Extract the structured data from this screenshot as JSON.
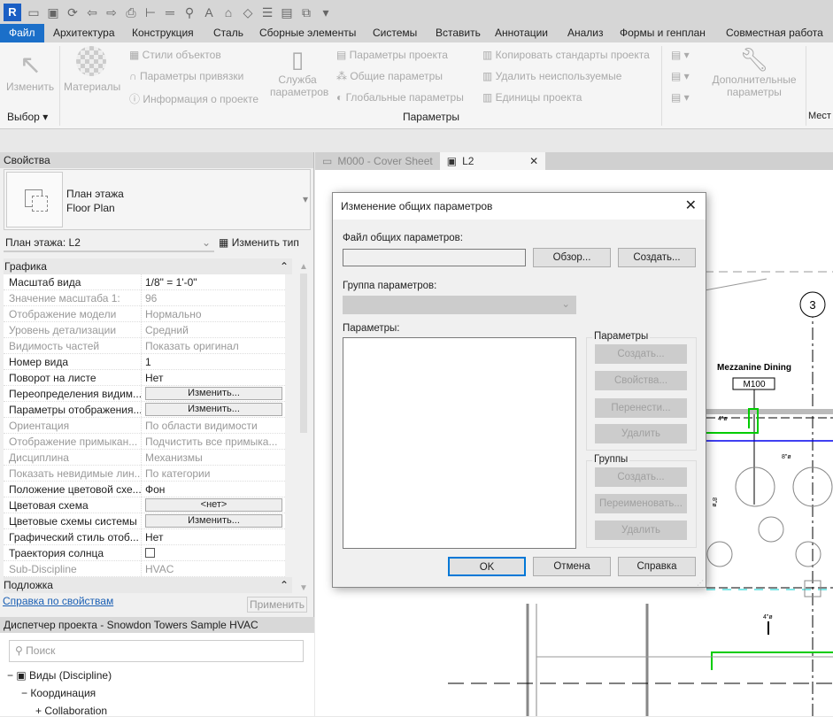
{
  "app": {
    "logo": "R",
    "qat_icons": [
      "open-icon",
      "save-icon",
      "sync-icon",
      "undo-icon",
      "redo-icon",
      "print-icon",
      "measure-icon",
      "dimension-icon",
      "tag-icon",
      "text-icon",
      "home-icon",
      "section-icon",
      "thin-lines-icon",
      "close-windows-icon",
      "switch-windows-icon",
      "customize-icon"
    ]
  },
  "ribbon_tabs": [
    "Файл",
    "Архитектура",
    "Конструкция",
    "Сталь",
    "Сборные элементы",
    "Системы",
    "Вставить",
    "Аннотации",
    "Анализ",
    "Формы и генплан",
    "Совместная работа"
  ],
  "ribbon": {
    "modify": "Изменить",
    "materials": "Материалы",
    "col1": [
      "Стили объектов",
      "Параметры привязки",
      "Информация о проекте"
    ],
    "service": [
      "Служба",
      "параметров"
    ],
    "col2": [
      "Параметры проекта",
      "Общие параметры",
      "Глобальные  параметры"
    ],
    "col3": [
      "Копировать стандарты проекта",
      "Удалить неиспользуемые",
      "Единицы проекта"
    ],
    "additional": [
      "Дополнительные",
      "параметры"
    ],
    "panel_select": "Выбор",
    "panel_params": "Параметры",
    "panel_next": "Мест"
  },
  "properties": {
    "header": "Свойства",
    "type_line1": "План этажа",
    "type_line2": "Floor Plan",
    "instance": "План этажа: L2",
    "edit_type": "Изменить тип",
    "group_graphics": "Графика",
    "rows": [
      {
        "k": "Масштаб вида",
        "v": "1/8\" = 1'-0\"",
        "dis": false
      },
      {
        "k": "Значение масштаба    1:",
        "v": "96",
        "dis": true
      },
      {
        "k": "Отображение модели",
        "v": "Нормально",
        "dis": true
      },
      {
        "k": "Уровень детализации",
        "v": "Средний",
        "dis": true
      },
      {
        "k": "Видимость частей",
        "v": "Показать оригинал",
        "dis": true
      },
      {
        "k": "Номер вида",
        "v": "1",
        "dis": false
      },
      {
        "k": "Поворот на листе",
        "v": "Нет",
        "dis": false
      },
      {
        "k": "Переопределения видим...",
        "btn": "Изменить...",
        "dis": false
      },
      {
        "k": "Параметры отображения...",
        "btn": "Изменить...",
        "dis": false
      },
      {
        "k": "Ориентация",
        "v": "По области видимости",
        "dis": true
      },
      {
        "k": "Отображение примыкан...",
        "v": "Подчистить все примыка...",
        "dis": true
      },
      {
        "k": "Дисциплина",
        "v": "Механизмы",
        "dis": true
      },
      {
        "k": "Показать невидимые лин...",
        "v": "По категории",
        "dis": true
      },
      {
        "k": "Положение цветовой схе...",
        "v": "Фон",
        "dis": false
      },
      {
        "k": "Цветовая схема",
        "btn": "<нет>",
        "dis": false
      },
      {
        "k": "Цветовые схемы системы",
        "btn": "Изменить...",
        "dis": false
      },
      {
        "k": "Графический стиль отоб...",
        "v": "Нет",
        "dis": false
      },
      {
        "k": "Траектория солнца",
        "checkbox": false,
        "dis": false
      },
      {
        "k": "Sub-Discipline",
        "v": "HVAC",
        "dis": true
      }
    ],
    "group_underlay": "Подложка",
    "help_link": "Справка по свойствам",
    "apply": "Применить"
  },
  "browser": {
    "header": "Диспетчер проекта - Snowdon Towers Sample HVAC",
    "search_placeholder": "Поиск",
    "tree": [
      {
        "label": "Виды (Discipline)",
        "sign": "−",
        "level": 0
      },
      {
        "label": "Координация",
        "sign": "−",
        "level": 1
      },
      {
        "label": "Collaboration",
        "sign": "+",
        "level": 2
      }
    ]
  },
  "view_tabs": [
    {
      "label": "M000 - Cover Sheet",
      "active": false
    },
    {
      "label": "L2",
      "active": true
    }
  ],
  "drawing": {
    "grid_label": "3",
    "room_name": "Mezzanine Dining",
    "room_number": "M100",
    "duct_labels": [
      "4\"ø",
      "8\"ø",
      "8\"ø",
      "4\"ø"
    ]
  },
  "dialog": {
    "title": "Изменение общих параметров",
    "file_label": "Файл общих параметров:",
    "file_value": "",
    "browse": "Обзор...",
    "create": "Создать...",
    "group_label": "Группа параметров:",
    "params_label": "Параметры:",
    "params_group": "Параметры",
    "params_buttons": [
      "Создать...",
      "Свойства...",
      "Перенести...",
      "Удалить"
    ],
    "groups_group": "Группы",
    "groups_buttons": [
      "Создать...",
      "Переименовать...",
      "Удалить"
    ],
    "ok": "OK",
    "cancel": "Отмена",
    "help": "Справка"
  },
  "colors": {
    "accent": "#1b6fc9",
    "duct_green": "#00d000",
    "duct_blue": "#0000e0"
  }
}
